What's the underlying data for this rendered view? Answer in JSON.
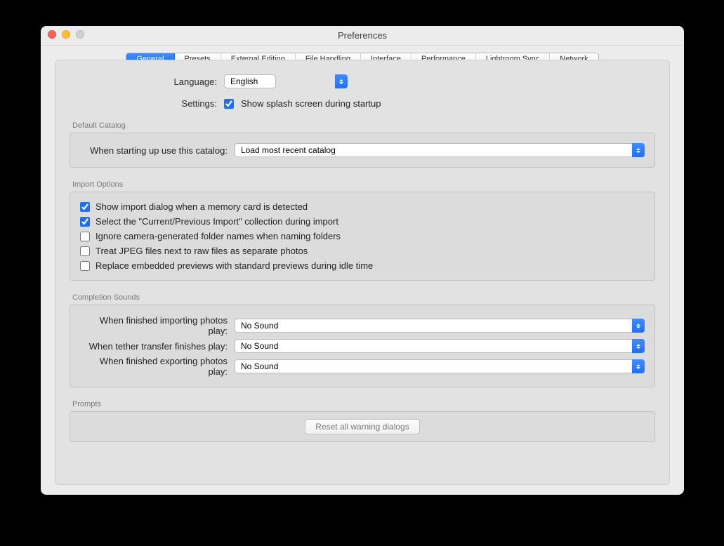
{
  "window": {
    "title": "Preferences"
  },
  "tabs": [
    {
      "label": "General",
      "active": true
    },
    {
      "label": "Presets",
      "active": false
    },
    {
      "label": "External Editing",
      "active": false
    },
    {
      "label": "File Handling",
      "active": false
    },
    {
      "label": "Interface",
      "active": false
    },
    {
      "label": "Performance",
      "active": false
    },
    {
      "label": "Lightroom Sync",
      "active": false
    },
    {
      "label": "Network",
      "active": false
    }
  ],
  "general": {
    "language_label": "Language:",
    "language_value": "English",
    "settings_label": "Settings:",
    "splash_checkbox": {
      "label": "Show splash screen during startup",
      "checked": true
    }
  },
  "default_catalog": {
    "section": "Default Catalog",
    "startup_label": "When starting up use this catalog:",
    "startup_value": "Load most recent catalog"
  },
  "import_options": {
    "section": "Import Options",
    "items": [
      {
        "label": "Show import dialog when a memory card is detected",
        "checked": true
      },
      {
        "label": "Select the \"Current/Previous Import\" collection during import",
        "checked": true
      },
      {
        "label": "Ignore camera-generated folder names when naming folders",
        "checked": false
      },
      {
        "label": "Treat JPEG files next to raw files as separate photos",
        "checked": false
      },
      {
        "label": "Replace embedded previews with standard previews during idle time",
        "checked": false
      }
    ]
  },
  "completion_sounds": {
    "section": "Completion Sounds",
    "rows": [
      {
        "label": "When finished importing photos play:",
        "value": "No Sound"
      },
      {
        "label": "When tether transfer finishes play:",
        "value": "No Sound"
      },
      {
        "label": "When finished exporting photos play:",
        "value": "No Sound"
      }
    ]
  },
  "prompts": {
    "section": "Prompts",
    "reset_button": "Reset all warning dialogs"
  }
}
